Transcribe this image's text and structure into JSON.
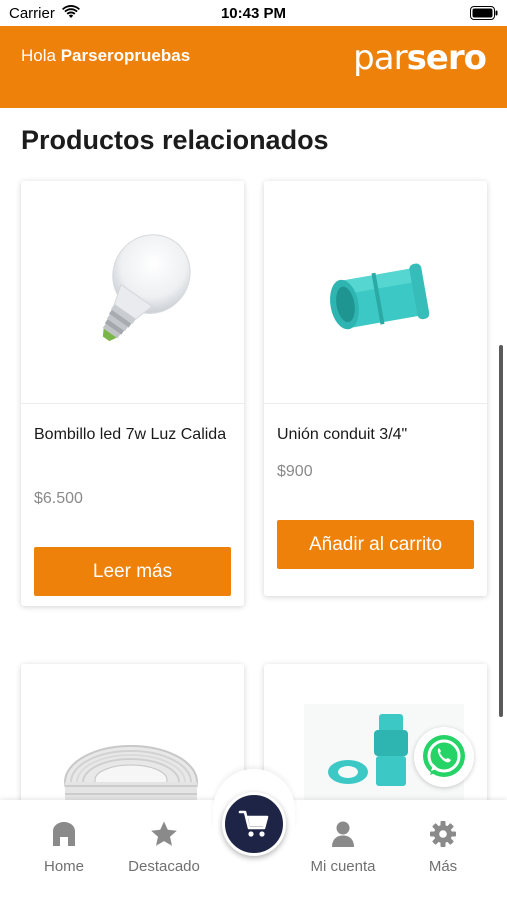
{
  "status_bar": {
    "carrier": "Carrier",
    "time": "10:43 PM"
  },
  "header": {
    "greeting_prefix": "Hola",
    "username": "Parseropruebas",
    "logo_light": "par",
    "logo_bold": "sero"
  },
  "main": {
    "section_title": "Productos relacionados",
    "products": [
      {
        "name": "Bombillo led 7w Luz Calida",
        "price": "$6.500",
        "button": "Leer más",
        "image": "light-bulb"
      },
      {
        "name": "Unión conduit 3/4\"",
        "price": "$900",
        "button": "Añadir al carrito",
        "image": "conduit-union"
      },
      {
        "name": "",
        "price": "",
        "button": "",
        "image": "cable-roll"
      },
      {
        "name": "",
        "price": "",
        "button": "",
        "image": "conduit-fittings"
      }
    ]
  },
  "bottom_nav": {
    "items": [
      {
        "label": "Home",
        "icon": "home-icon"
      },
      {
        "label": "Destacado",
        "icon": "star-icon"
      },
      {
        "label": "Mi cuenta",
        "icon": "user-icon"
      },
      {
        "label": "Más",
        "icon": "gear-icon"
      }
    ],
    "center": {
      "icon": "cart-icon"
    }
  },
  "colors": {
    "brand": "#ee8109",
    "cart_button": "#1e2445",
    "whatsapp": "#25d366",
    "nav_label": "#707070"
  }
}
